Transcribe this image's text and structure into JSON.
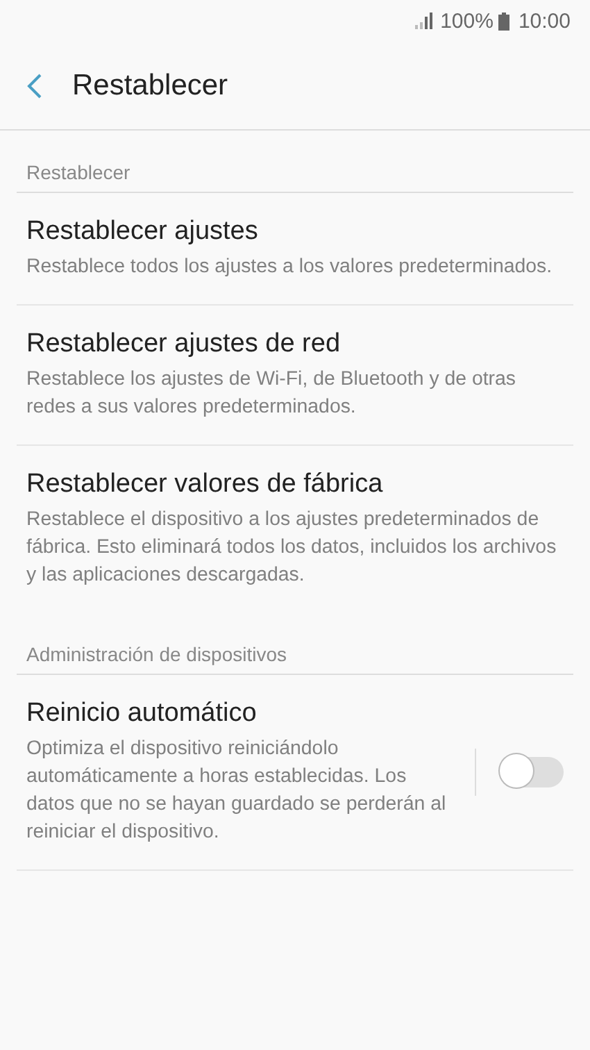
{
  "status_bar": {
    "battery": "100%",
    "time": "10:00"
  },
  "header": {
    "title": "Restablecer"
  },
  "sections": [
    {
      "title": "Restablecer",
      "items": [
        {
          "kind": "plain",
          "title": "Restablecer ajustes",
          "description": "Restablece todos los ajustes a los valores predeterminados."
        },
        {
          "kind": "plain",
          "title": "Restablecer ajustes de red",
          "description": "Restablece los ajustes de Wi-Fi, de Bluetooth y de otras redes a sus valores predeterminados."
        },
        {
          "kind": "plain",
          "title": "Restablecer valores de fábrica",
          "description": "Restablece el dispositivo a los ajustes predeterminados de fábrica. Esto eliminará todos los datos, incluidos los archivos y las aplicaciones descargadas."
        }
      ]
    },
    {
      "title": "Administración de dispositivos",
      "items": [
        {
          "kind": "toggle",
          "title": "Reinicio automático",
          "description": "Optimiza el dispositivo reiniciándolo automáticamente a horas establecidas. Los datos que no se hayan guardado se perderán al reiniciar el dispositivo.",
          "on": false
        }
      ]
    }
  ]
}
